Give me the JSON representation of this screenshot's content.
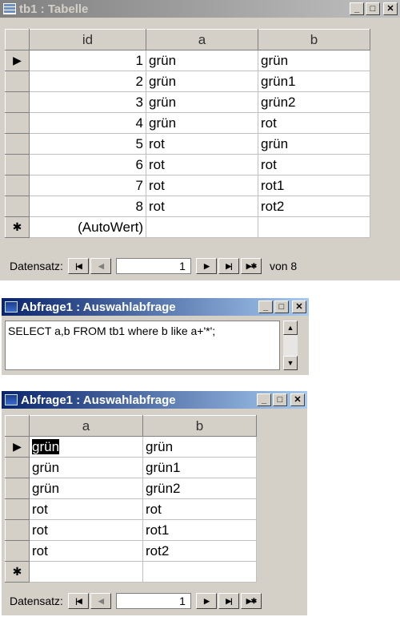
{
  "window1": {
    "title": "tb1 : Tabelle",
    "columns": [
      "id",
      "a",
      "b"
    ],
    "rows": [
      {
        "marker": "▶",
        "id": "1",
        "a": "grün",
        "b": "grün"
      },
      {
        "marker": "",
        "id": "2",
        "a": "grün",
        "b": "grün1"
      },
      {
        "marker": "",
        "id": "3",
        "a": "grün",
        "b": "grün2"
      },
      {
        "marker": "",
        "id": "4",
        "a": "grün",
        "b": "rot"
      },
      {
        "marker": "",
        "id": "5",
        "a": "rot",
        "b": "grün"
      },
      {
        "marker": "",
        "id": "6",
        "a": "rot",
        "b": "rot"
      },
      {
        "marker": "",
        "id": "7",
        "a": "rot",
        "b": "rot1"
      },
      {
        "marker": "",
        "id": "8",
        "a": "rot",
        "b": "rot2"
      }
    ],
    "new_row": {
      "marker": "✱",
      "id": "(AutoWert)",
      "a": "",
      "b": ""
    },
    "nav": {
      "label": "Datensatz:",
      "current": "1",
      "total_text": "von  8"
    }
  },
  "window2": {
    "title": "Abfrage1 : Auswahlabfrage",
    "sql": "SELECT a,b FROM tb1 where b like a+'*';"
  },
  "window3": {
    "title": "Abfrage1 : Auswahlabfrage",
    "columns": [
      "a",
      "b"
    ],
    "rows": [
      {
        "marker": "▶",
        "a": "grün",
        "b": "grün"
      },
      {
        "marker": "",
        "a": "grün",
        "b": "grün1"
      },
      {
        "marker": "",
        "a": "grün",
        "b": "grün2"
      },
      {
        "marker": "",
        "a": "rot",
        "b": "rot"
      },
      {
        "marker": "",
        "a": "rot",
        "b": "rot1"
      },
      {
        "marker": "",
        "a": "rot",
        "b": "rot2"
      }
    ],
    "new_row": {
      "marker": "✱",
      "a": "",
      "b": ""
    },
    "nav": {
      "label": "Datensatz:",
      "current": "1"
    }
  },
  "window_buttons": {
    "minimize": "_",
    "maximize": "□",
    "close": "✕"
  },
  "nav_symbols": {
    "first": "|◀",
    "prev": "◀",
    "next": "▶",
    "last": "▶|",
    "new": "▶✱"
  },
  "scroll_symbols": {
    "up": "▲",
    "down": "▼"
  },
  "colors": {
    "active_title": "#0a246a",
    "inactive_title": "#808080",
    "face": "#d4d0c8"
  }
}
